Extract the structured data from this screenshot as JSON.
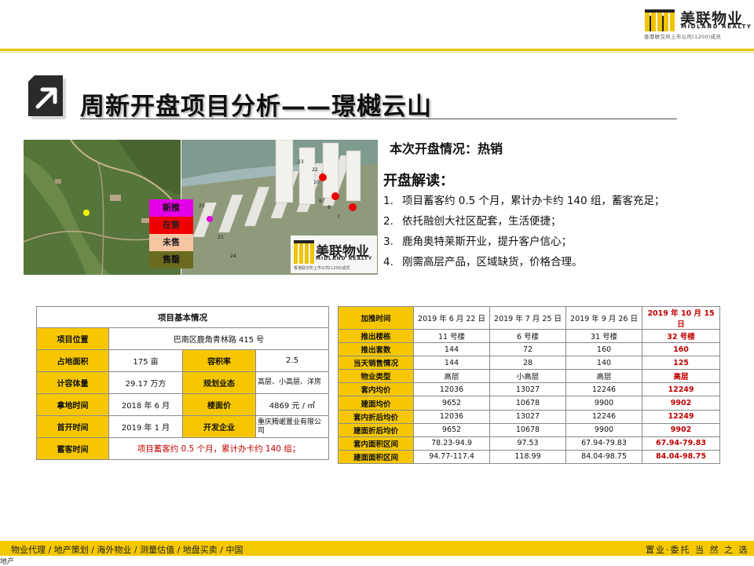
{
  "logo": {
    "name": "美联物业",
    "sub": "MIDLAND REALTY",
    "tagline": "香港联交所上市公司(1200)成员",
    "colors": {
      "gold": "#f0c400",
      "dark": "#222222"
    }
  },
  "title": "周新开盘项目分析——璟樾云山",
  "title_icon": "arrow-up-right-icon",
  "legend": {
    "items": [
      {
        "label": "新推",
        "color": "#e400e4"
      },
      {
        "label": "在售",
        "color": "#ef0000"
      },
      {
        "label": "未售",
        "color": "#f6c6a2"
      },
      {
        "label": "售罄",
        "color": "#6b6b1f"
      }
    ]
  },
  "render_building_labels": [
    "23",
    "22",
    "10",
    "9",
    "8",
    "7",
    "21",
    "25",
    "24"
  ],
  "stamp": {
    "name": "美联物业",
    "sub": "MIDLAND REALTY",
    "tagline": "香港联交所上市公司(1200)成员"
  },
  "sale_status": "本次开盘情况：热销",
  "interpretation": {
    "heading": "开盘解读：",
    "items": [
      {
        "num": "1.",
        "text": "项目蓄客约 0.5 个月，累计办卡约 140 组，蓄客充足；"
      },
      {
        "num": "2.",
        "text": "依托融创大社区配套，生活便捷；"
      },
      {
        "num": "3.",
        "text": "鹿角奥特莱斯开业，提升客户信心；"
      },
      {
        "num": "4.",
        "text": "刚需高层产品，区域缺货，价格合理。"
      }
    ]
  },
  "basic_info": {
    "header": "项目基本情况",
    "location_label": "项目位置",
    "location_value": "巴南区鹿角青林路 415 号",
    "area_label": "占地面积",
    "area_value": "175 亩",
    "far_label": "容积率",
    "far_value": "2.5",
    "gfa_label": "计容体量",
    "gfa_value": "29.17 万方",
    "format_label": "规划业态",
    "format_value": "高层、小高层、洋房",
    "land_time_label": "拿地时间",
    "land_time_value": "2018 年 6 月",
    "land_price_label": "楼面价",
    "land_price_value": "4869 元 / ㎡",
    "open_time_label": "首开时间",
    "open_time_value": "2019 年 1 月",
    "developer_label": "开发企业",
    "developer_value": "重庆腾岷置业有限公司",
    "reserve_label": "蓄客时间",
    "reserve_value": "项目蓄客约 0.5 个月，累计办卡约 140 组；"
  },
  "ops_table": {
    "header_label": "加推时间",
    "columns": [
      "2019 年 6 月 22 日",
      "2019 年 7 月 25 日",
      "2019 年 9 月 26 日",
      "2019 年 10 月 15 日"
    ],
    "rows": [
      {
        "label": "推出楼栋",
        "values": [
          "11 号楼",
          "6 号楼",
          "31 号楼",
          "32 号楼"
        ]
      },
      {
        "label": "推出套数",
        "values": [
          "144",
          "72",
          "160",
          "160"
        ]
      },
      {
        "label": "当天销售情况",
        "values": [
          "144",
          "28",
          "140",
          "125"
        ]
      },
      {
        "label": "物业类型",
        "values": [
          "高层",
          "小高层",
          "高层",
          "高层"
        ]
      },
      {
        "label": "套内均价",
        "values": [
          "12036",
          "13027",
          "12246",
          "12249"
        ]
      },
      {
        "label": "建面均价",
        "values": [
          "9652",
          "10678",
          "9900",
          "9902"
        ]
      },
      {
        "label": "套内折后均价",
        "values": [
          "12036",
          "13027",
          "12246",
          "12249"
        ]
      },
      {
        "label": "建面折后均价",
        "values": [
          "9652",
          "10678",
          "9900",
          "9902"
        ]
      },
      {
        "label": "套内面积区间",
        "values": [
          "78.23-94.9",
          "97.53",
          "67.94-79.83",
          "67.94-79.83"
        ]
      },
      {
        "label": "建面面积区间",
        "values": [
          "94.77-117.4",
          "118.99",
          "84.04-98.75",
          "84.04-98.75"
        ]
      }
    ],
    "highlight_color": "#c00000"
  },
  "footer": {
    "nav": "物业代理 / 地产策划 / 海外物业 / 测量估值 / 地盘买卖 / 中国",
    "slogan": "置业·委托 当 然 之 选",
    "corner_tag": "地产"
  }
}
